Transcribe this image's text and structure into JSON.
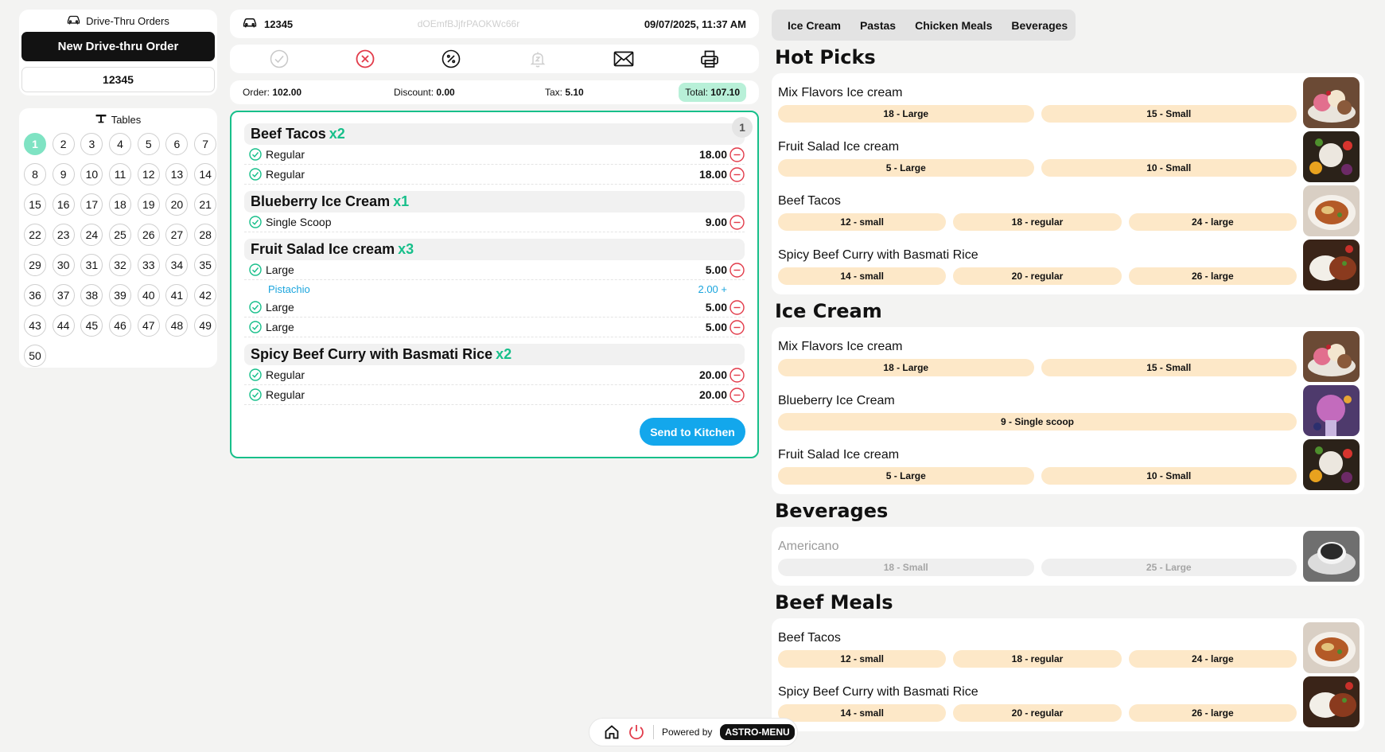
{
  "drive_thru": {
    "title": "Drive-Thru Orders",
    "new_order_label": "New Drive-thru Order",
    "current_order": "12345"
  },
  "tables": {
    "title": "Tables",
    "active": 1,
    "items": [
      "1",
      "2",
      "3",
      "4",
      "5",
      "6",
      "7",
      "8",
      "9",
      "10",
      "11",
      "12",
      "13",
      "14",
      "15",
      "16",
      "17",
      "18",
      "19",
      "20",
      "21",
      "22",
      "23",
      "24",
      "25",
      "26",
      "27",
      "28",
      "29",
      "30",
      "31",
      "32",
      "33",
      "34",
      "35",
      "36",
      "37",
      "38",
      "39",
      "40",
      "41",
      "42",
      "43",
      "44",
      "45",
      "46",
      "47",
      "48",
      "49",
      "50"
    ]
  },
  "order_header": {
    "order_number": "12345",
    "order_id": "dOEmfBJjfrPAOKWc66r",
    "datetime": "09/07/2025, 11:37 AM"
  },
  "totals": {
    "order_label": "Order:",
    "order_value": "102.00",
    "discount_label": "Discount:",
    "discount_value": "0.00",
    "tax_label": "Tax:",
    "tax_value": "5.10",
    "total_label": "Total:",
    "total_value": "107.10"
  },
  "order": {
    "count": "1",
    "send_label": "Send to Kitchen",
    "groups": [
      {
        "name": "Beef Tacos",
        "qty": "x2",
        "lines": [
          {
            "name": "Regular",
            "price": "18.00"
          },
          {
            "name": "Regular",
            "price": "18.00"
          }
        ]
      },
      {
        "name": "Blueberry Ice Cream",
        "qty": "x1",
        "lines": [
          {
            "name": "Single Scoop",
            "price": "9.00"
          }
        ]
      },
      {
        "name": "Fruit Salad Ice cream",
        "qty": "x3",
        "lines": [
          {
            "name": "Large",
            "price": "5.00"
          },
          {
            "name": "Pistachio",
            "price": "2.00 +",
            "modifier": true
          },
          {
            "name": "Large",
            "price": "5.00"
          },
          {
            "name": "Large",
            "price": "5.00"
          }
        ]
      },
      {
        "name": "Spicy Beef Curry with Basmati Rice",
        "qty": "x2",
        "lines": [
          {
            "name": "Regular",
            "price": "20.00"
          },
          {
            "name": "Regular",
            "price": "20.00"
          }
        ]
      }
    ]
  },
  "categories": [
    "Ice Cream",
    "Pastas",
    "Chicken Meals",
    "Beverages"
  ],
  "sections": [
    {
      "title": "Hot Picks",
      "items": [
        {
          "name": "Mix Flavors Ice cream",
          "sizes": [
            "18 - Large",
            "15 - Small"
          ],
          "thumb": "mix"
        },
        {
          "name": "Fruit Salad Ice cream",
          "sizes": [
            "5 - Large",
            "10 - Small"
          ],
          "thumb": "fruit"
        },
        {
          "name": "Beef Tacos",
          "sizes": [
            "12 - small",
            "18 - regular",
            "24 - large"
          ],
          "thumb": "tacos"
        },
        {
          "name": "Spicy Beef Curry with Basmati Rice",
          "sizes": [
            "14 - small",
            "20 - regular",
            "26 - large"
          ],
          "thumb": "curry"
        }
      ]
    },
    {
      "title": "Ice Cream",
      "items": [
        {
          "name": "Mix Flavors Ice cream",
          "sizes": [
            "18 - Large",
            "15 - Small"
          ],
          "thumb": "mix"
        },
        {
          "name": "Blueberry Ice Cream",
          "sizes": [
            "9 - Single scoop"
          ],
          "thumb": "blueberry"
        },
        {
          "name": "Fruit Salad Ice cream",
          "sizes": [
            "5 - Large",
            "10 - Small"
          ],
          "thumb": "fruit"
        }
      ]
    },
    {
      "title": "Beverages",
      "items": [
        {
          "name": "Americano",
          "sizes": [
            "18 - Small",
            "25 - Large"
          ],
          "thumb": "coffee",
          "disabled": true
        }
      ]
    },
    {
      "title": "Beef Meals",
      "items": [
        {
          "name": "Beef Tacos",
          "sizes": [
            "12 - small",
            "18 - regular",
            "24 - large"
          ],
          "thumb": "tacos"
        },
        {
          "name": "Spicy Beef Curry with Basmati Rice",
          "sizes": [
            "14 - small",
            "20 - regular",
            "26 - large"
          ],
          "thumb": "curry"
        }
      ]
    }
  ],
  "footer": {
    "powered_by": "Powered by",
    "brand": "ASTRO-MENU"
  },
  "colors": {
    "accent_green": "#17bf8a",
    "send_blue": "#13a7ec",
    "remove_red": "#e23b4a",
    "size_pill": "#fde8c8"
  }
}
